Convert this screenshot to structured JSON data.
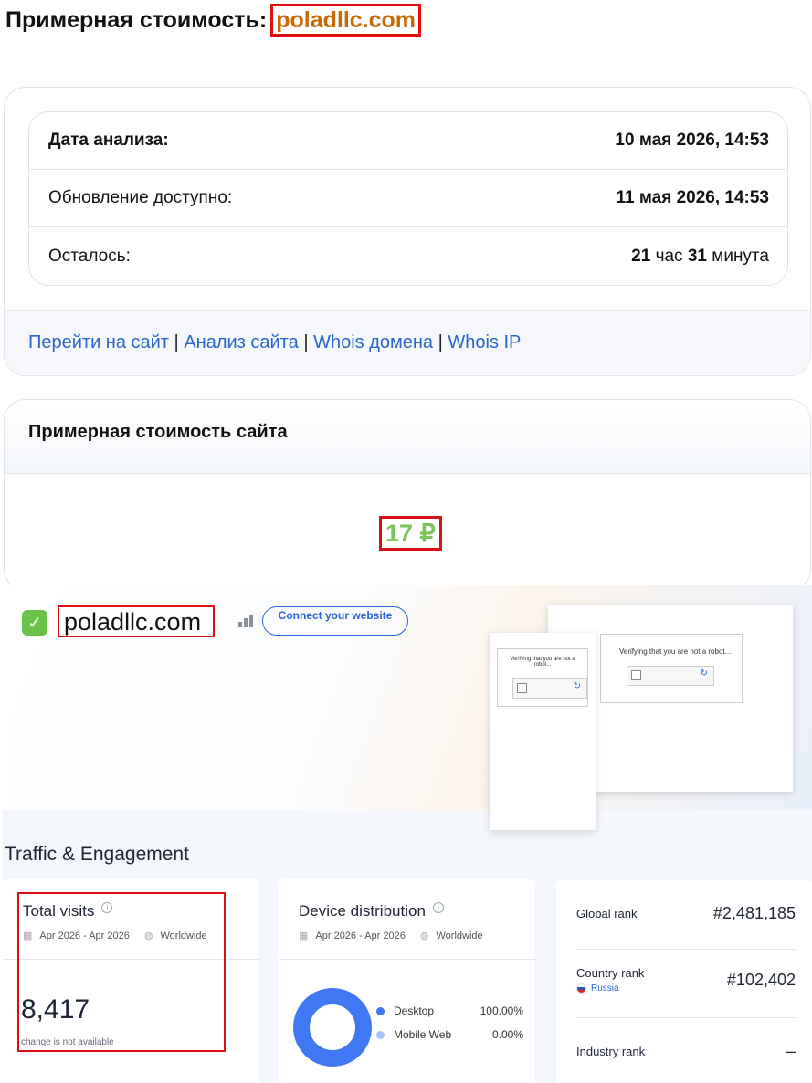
{
  "header": {
    "title": "Примерная стоимость:",
    "domain": "poladllc.com"
  },
  "analysis": {
    "date_label": "Дата анализа:",
    "date_value": "10 мая 2026, 14:53",
    "update_label": "Обновление доступно:",
    "update_value": "11 мая 2026, 14:53",
    "remaining_label": "Осталось:",
    "remaining_hours": "21",
    "remaining_hours_unit": "час",
    "remaining_minutes": "31",
    "remaining_minutes_unit": "минута"
  },
  "links": {
    "go_to_site": "Перейти на сайт",
    "site_analysis": "Анализ сайта",
    "whois_domain": "Whois домена",
    "whois_ip": "Whois IP",
    "separator": "|"
  },
  "value_card": {
    "title": "Примерная стоимость сайта",
    "price": "17 ₽"
  },
  "similarweb": {
    "domain": "poladllc.com",
    "connect_button": "Connect your website",
    "captcha_text": "Verifying that you are not a robot...",
    "captcha_text_small": "Verifying that you are not a robot...",
    "section_title": "Traffic & Engagement",
    "total_visits": {
      "title": "Total visits",
      "date_range": "Apr 2026 - Apr 2026",
      "region": "Worldwide",
      "value": "8,417",
      "change_note": "change is not available"
    },
    "device_distribution": {
      "title": "Device distribution",
      "date_range": "Apr 2026 - Apr 2026",
      "region": "Worldwide",
      "items": [
        {
          "name": "Desktop",
          "value": "100.00%",
          "color": "#3f78f2"
        },
        {
          "name": "Mobile Web",
          "value": "0.00%",
          "color": "#a8c6f7"
        }
      ]
    },
    "ranks": {
      "global_label": "Global rank",
      "global_value": "#2,481,185",
      "country_label": "Country rank",
      "country_name": "Russia",
      "country_value": "#102,402",
      "industry_label": "Industry rank",
      "industry_value": "–"
    }
  }
}
